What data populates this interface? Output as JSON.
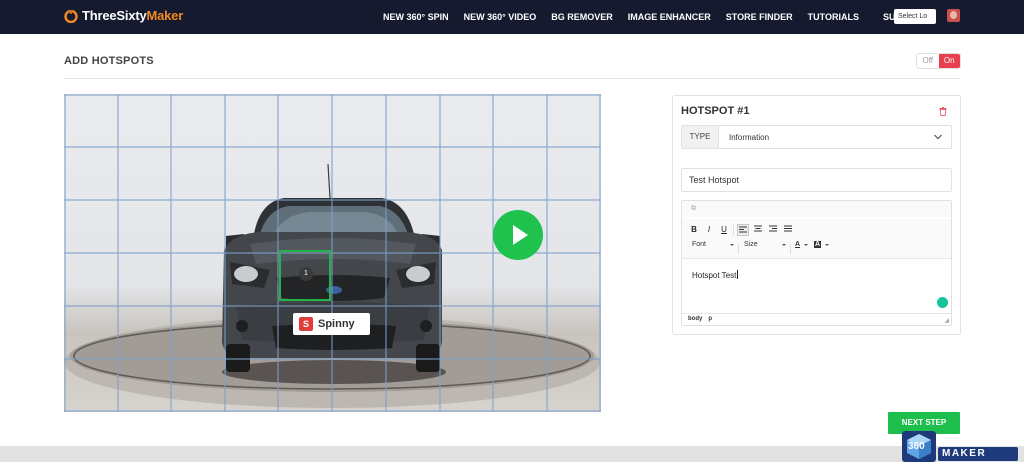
{
  "brand": {
    "name_part1": "ThreeSixty",
    "name_part2": "Maker",
    "accent_color": "#f08a24"
  },
  "nav": {
    "items": [
      {
        "label": "NEW 360° SPIN"
      },
      {
        "label": "NEW 360° VIDEO"
      },
      {
        "label": "BG REMOVER"
      },
      {
        "label": "IMAGE ENHANCER"
      },
      {
        "label": "STORE FINDER"
      },
      {
        "label": "TUTORIALS"
      }
    ],
    "support_label": "SUPPORT",
    "button_label": "Select Lo"
  },
  "header": {
    "title": "ADD HOTSPOTS",
    "toggle_off": "Off",
    "toggle_on": "On",
    "toggle_state": "on"
  },
  "viewer": {
    "hotspot_number": "1",
    "plate_text": "Spinny",
    "plate_logo": "S",
    "play_icon": "play-icon",
    "grid_columns": 10,
    "grid_rows": 6
  },
  "panel": {
    "title": "HOTSPOT #1",
    "type_label": "TYPE",
    "type_value": "Information",
    "name_value": "Test Hotspot",
    "toolbar": {
      "bold": "B",
      "italic": "I",
      "underline": "U",
      "font_label": "Font",
      "size_label": "Size",
      "text_color_label": "A",
      "bg_color_label": "A"
    },
    "editor_text": "Hotspot Test",
    "status_path": [
      "body",
      "p"
    ]
  },
  "footer": {
    "next_label": "NEXT STEP",
    "watermark_badge": "360",
    "watermark_text": "MAKER"
  },
  "colors": {
    "navbar": "#161a2e",
    "green": "#1ebe4d",
    "toggle_on": "#e8404e"
  }
}
